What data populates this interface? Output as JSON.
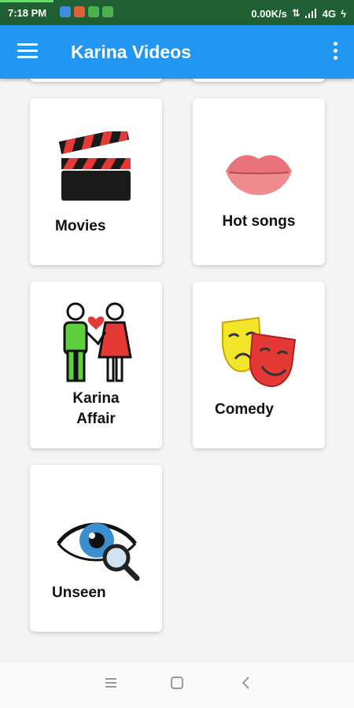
{
  "status_bar": {
    "time": "7:18 PM",
    "network_speed": "0.00K/s",
    "signal_type": "4G",
    "icons": [
      "notification-icon",
      "notification-icon",
      "notification-icon",
      "notification-icon",
      "data-transfer-icon",
      "signal-icon",
      "battery-charging-icon"
    ]
  },
  "app_bar": {
    "title": "Karina Videos",
    "menu_icon": "hamburger-menu-icon",
    "more_icon": "more-vertical-icon"
  },
  "categories": [
    {
      "label": "Movies",
      "icon": "clapperboard-icon"
    },
    {
      "label": "Hot songs",
      "icon": "lips-icon"
    },
    {
      "label": "Karina\nAffair",
      "icon": "couple-heart-icon"
    },
    {
      "label": "Comedy",
      "icon": "comedy-masks-icon"
    },
    {
      "label": "Unseen",
      "icon": "eye-magnifier-icon"
    }
  ],
  "nav_bar": {
    "icons": [
      "recent-apps-icon",
      "home-icon",
      "back-icon"
    ]
  },
  "colors": {
    "app_bar": "#2196f3",
    "status_bar": "#1f5f33",
    "background": "#f5f5f5",
    "card": "#ffffff"
  }
}
